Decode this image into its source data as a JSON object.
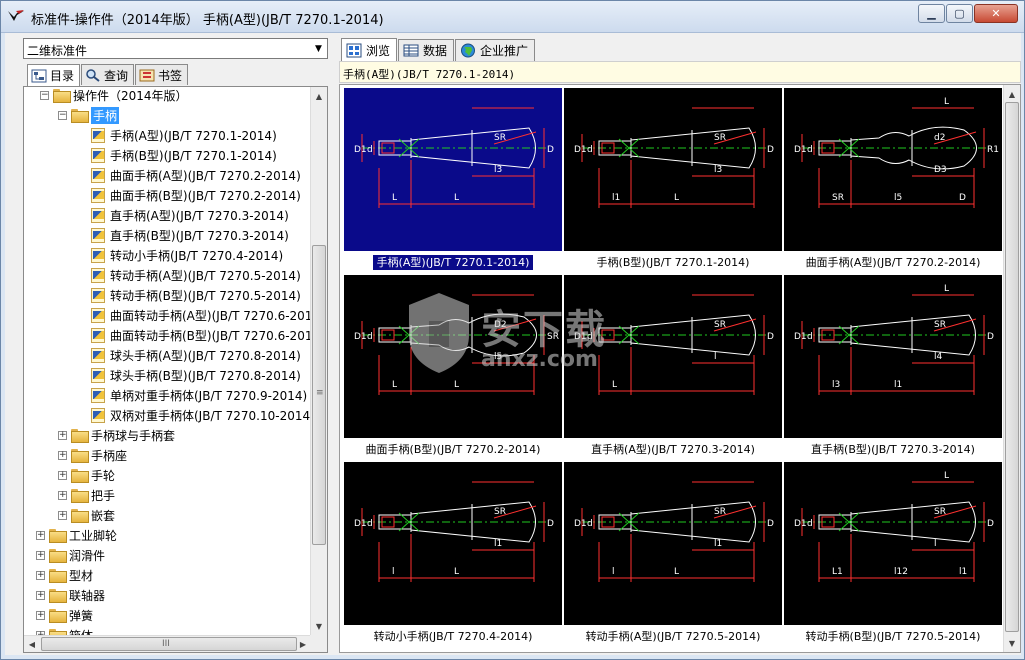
{
  "window": {
    "title": "标准件-操作件（2014年版） 手柄(A型)(JB/T 7270.1-2014)"
  },
  "left_panel": {
    "combo_value": "二维标准件",
    "tabs": [
      {
        "label": "目录",
        "icon": "tree-icon"
      },
      {
        "label": "查询",
        "icon": "search-icon"
      },
      {
        "label": "书签",
        "icon": "bookmark-icon"
      }
    ],
    "tree": {
      "root": "操作件（2014年版）",
      "selected_folder": "手柄",
      "items": [
        "手柄(A型)(JB/T 7270.1-2014)",
        "手柄(B型)(JB/T 7270.1-2014)",
        "曲面手柄(A型)(JB/T 7270.2-2014)",
        "曲面手柄(B型)(JB/T 7270.2-2014)",
        "直手柄(A型)(JB/T 7270.3-2014)",
        "直手柄(B型)(JB/T 7270.3-2014)",
        "转动小手柄(JB/T 7270.4-2014)",
        "转动手柄(A型)(JB/T 7270.5-2014)",
        "转动手柄(B型)(JB/T 7270.5-2014)",
        "曲面转动手柄(A型)(JB/T 7270.6-2014)",
        "曲面转动手柄(B型)(JB/T 7270.6-2014)",
        "球头手柄(A型)(JB/T 7270.8-2014)",
        "球头手柄(B型)(JB/T 7270.8-2014)",
        "单柄对重手柄体(JB/T 7270.9-2014)",
        "双柄对重手柄体(JB/T 7270.10-2014)"
      ],
      "sibling_folders": [
        "手柄球与手柄套",
        "手柄座",
        "手轮",
        "把手",
        "嵌套"
      ],
      "top_folders": [
        "工业脚轮",
        "润滑件",
        "型材",
        "联轴器",
        "弹簧",
        "箱体"
      ],
      "hscroll_grip": "III",
      "vscroll_grip": "≡"
    }
  },
  "right_panel": {
    "tabs": [
      {
        "label": "浏览",
        "icon": "browse-icon"
      },
      {
        "label": "数据",
        "icon": "table-icon"
      },
      {
        "label": "企业推广",
        "icon": "globe-icon"
      }
    ],
    "path": "手柄(A型)(JB/T 7270.1-2014)",
    "thumbnails": [
      {
        "caption": "手柄(A型)(JB/T 7270.1-2014)",
        "selected": true,
        "labels": [
          "D1",
          "d",
          "SR",
          "D",
          "l3",
          "L",
          "L"
        ]
      },
      {
        "caption": "手柄(B型)(JB/T 7270.1-2014)",
        "selected": false,
        "labels": [
          "D1",
          "d",
          "SR",
          "D",
          "l3",
          "l1",
          "L"
        ]
      },
      {
        "caption": "曲面手柄(A型)(JB/T 7270.2-2014)",
        "selected": false,
        "labels": [
          "D1",
          "d",
          "d2",
          "R1",
          "D3",
          "SR",
          "l5",
          "L",
          "D"
        ]
      },
      {
        "caption": "曲面手柄(B型)(JB/T 7270.2-2014)",
        "selected": false,
        "labels": [
          "D1",
          "d",
          "D2",
          "SR",
          "l5",
          "L",
          "L"
        ]
      },
      {
        "caption": "直手柄(A型)(JB/T 7270.3-2014)",
        "selected": false,
        "labels": [
          "D1",
          "d",
          "SR",
          "D",
          "l",
          "L"
        ]
      },
      {
        "caption": "直手柄(B型)(JB/T 7270.3-2014)",
        "selected": false,
        "labels": [
          "D1",
          "d",
          "SR",
          "D",
          "l4",
          "l3",
          "l1",
          "L"
        ]
      },
      {
        "caption": "转动小手柄(JB/T 7270.4-2014)",
        "selected": false,
        "labels": [
          "D1",
          "d",
          "SR",
          "D",
          "l1",
          "l",
          "L"
        ]
      },
      {
        "caption": "转动手柄(A型)(JB/T 7270.5-2014)",
        "selected": false,
        "labels": [
          "D1",
          "d",
          "SR",
          "D",
          "l1",
          "l",
          "L"
        ]
      },
      {
        "caption": "转动手柄(B型)(JB/T 7270.5-2014)",
        "selected": false,
        "labels": [
          "D1",
          "d",
          "SR",
          "D",
          "l",
          "L1",
          "l12",
          "L",
          "l1"
        ]
      }
    ]
  },
  "watermark": {
    "text": "安下载",
    "sub": "anxz.com"
  },
  "colors": {
    "drawing_outline": "#ffffff",
    "dimension": "#ff3030",
    "centerline": "#21c821",
    "selected_bg": "#0a0a8a",
    "tree_selection": "#3399ff"
  }
}
